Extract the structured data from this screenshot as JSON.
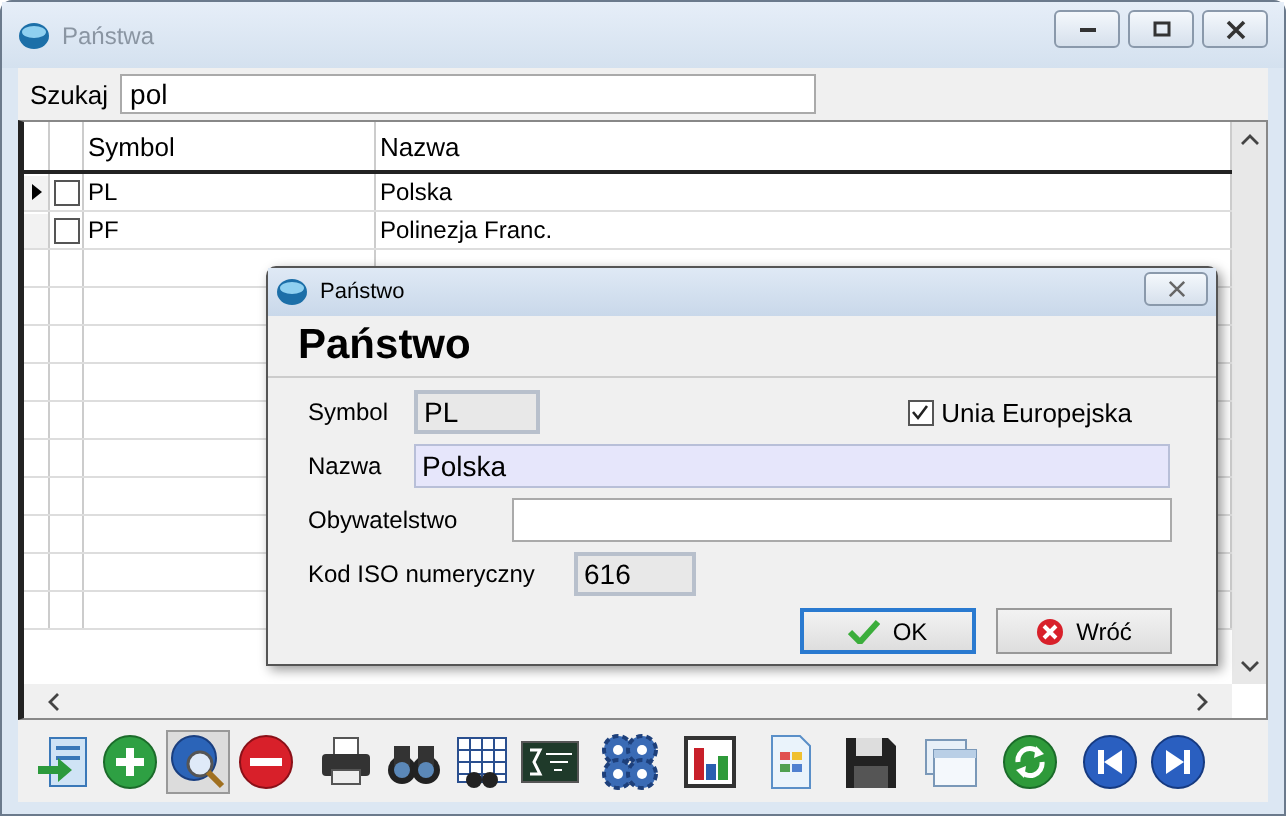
{
  "window": {
    "title": "Państwa"
  },
  "search": {
    "label": "Szukaj",
    "value": "pol"
  },
  "table": {
    "columns": [
      "Symbol",
      "Nazwa"
    ],
    "rows": [
      {
        "current": true,
        "checked": false,
        "symbol": "PL",
        "name": "Polska"
      },
      {
        "current": false,
        "checked": false,
        "symbol": "PF",
        "name": "Polinezja Franc."
      }
    ]
  },
  "toolbar": [
    {
      "kind": "export",
      "selected": false
    },
    {
      "kind": "add",
      "selected": false
    },
    {
      "kind": "preview",
      "selected": true
    },
    {
      "kind": "delete",
      "selected": false
    },
    {
      "kind": "print",
      "selected": false
    },
    {
      "kind": "binoculars",
      "selected": false
    },
    {
      "kind": "grid-search",
      "selected": false
    },
    {
      "kind": "formula",
      "selected": false
    },
    {
      "kind": "gears",
      "selected": false
    },
    {
      "kind": "chart",
      "selected": false
    },
    {
      "kind": "document",
      "selected": false
    },
    {
      "kind": "save",
      "selected": false
    },
    {
      "kind": "windows",
      "selected": false
    },
    {
      "kind": "refresh",
      "selected": false
    },
    {
      "kind": "first",
      "selected": false
    },
    {
      "kind": "last",
      "selected": false
    }
  ],
  "dialog": {
    "title": "Państwo",
    "heading": "Państwo",
    "checkbox": {
      "label": "Unia Europejska",
      "checked": true
    },
    "fields": [
      {
        "label": "Symbol",
        "value": "PL",
        "kind": "readonly"
      },
      {
        "label": "Nazwa",
        "value": "Polska",
        "kind": "focused"
      },
      {
        "label": "Obywatelstwo",
        "kind": "normal"
      },
      {
        "label": "Kod ISO numeryczny",
        "value": "616",
        "kind": "readonly"
      }
    ],
    "buttons": [
      {
        "label": "OK",
        "kind": "ok",
        "default": true
      },
      {
        "label": "Wróć",
        "kind": "cancel",
        "default": false
      }
    ]
  }
}
